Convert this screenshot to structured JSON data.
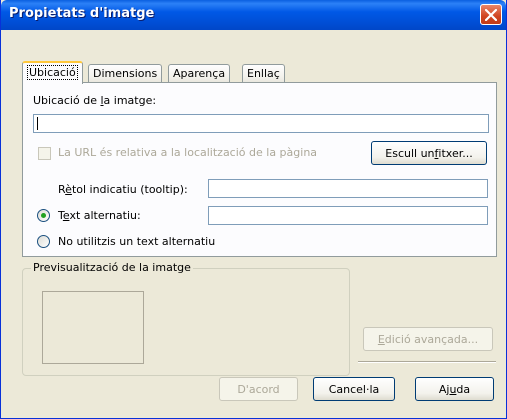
{
  "window": {
    "title": "Propietats d'imatge"
  },
  "tabs": [
    {
      "label": "Ubicació"
    },
    {
      "label": "Dimensions"
    },
    {
      "label": "Aparença"
    },
    {
      "label": "Enllaç"
    }
  ],
  "location": {
    "label_pre": "Ubicació de ",
    "label_ul": "l",
    "label_post": "a imatge:",
    "value": ""
  },
  "relative_url": {
    "label": "La URL és relativa a la localització de la pàgina",
    "checked": false,
    "enabled": false
  },
  "choose_file": {
    "label_pre": "Escull un ",
    "label_ul": "f",
    "label_post": "itxer..."
  },
  "tooltip": {
    "label_pre": "R",
    "label_ul": "è",
    "label_post": "tol indicatiu (tooltip):",
    "value": ""
  },
  "alt_text": {
    "label_pre": "T",
    "label_ul": "e",
    "label_post": "xt alternatiu:",
    "value": "",
    "selected": true
  },
  "no_alt": {
    "label": "No utilitzis un text alternatiu",
    "selected": false
  },
  "preview": {
    "title": "Previsualització de la imatge"
  },
  "advanced_edit": {
    "label_ul": "E",
    "label_post": "dició avançada..."
  },
  "buttons": {
    "ok": "D'acord",
    "cancel": "Cancel·la",
    "help_pre": "Aj",
    "help_ul": "u",
    "help_post": "da"
  },
  "colors": {
    "titlebar": "#0055e5",
    "dialog_bg": "#ece9d8",
    "active_tab_highlight": "#ffc83c",
    "close_button": "#d0441f"
  }
}
